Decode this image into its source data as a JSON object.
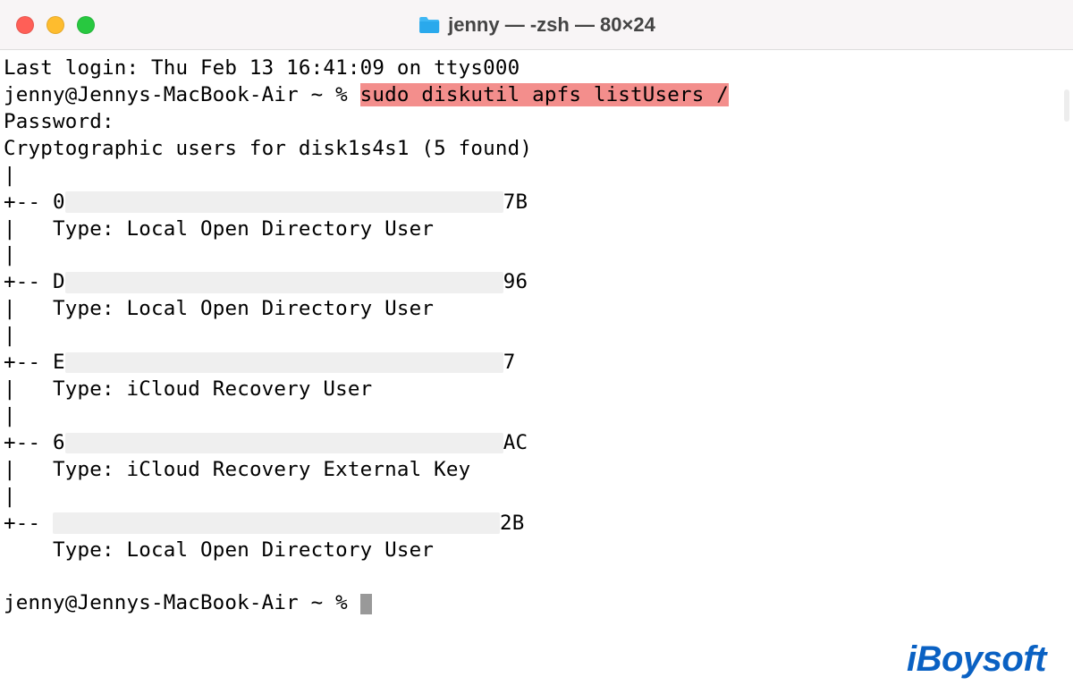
{
  "titlebar": {
    "title": "jenny — -zsh — 80×24"
  },
  "terminal": {
    "last_login": "Last login: Thu Feb 13 16:41:09 on ttys000",
    "prompt1_prefix": "jenny@Jennys-MacBook-Air ~ % ",
    "command1": "sudo diskutil apfs listUsers /",
    "password_line": "Password:",
    "result_header": "Cryptographic users for disk1s4s1 (5 found)",
    "users": [
      {
        "prefix": "+-- 0",
        "suffix": "7B",
        "type": "Type: Local Open Directory User"
      },
      {
        "prefix": "+-- D",
        "suffix": "96",
        "type": "Type: Local Open Directory User"
      },
      {
        "prefix": "+-- E",
        "suffix": "7",
        "type": "Type: iCloud Recovery User"
      },
      {
        "prefix": "+-- 6",
        "suffix": "AC",
        "type": "Type: iCloud Recovery External Key"
      },
      {
        "prefix": "+-- ",
        "suffix": "2B",
        "type": "Type: Local Open Directory User"
      }
    ],
    "pipe": "|",
    "type_indent": "|   ",
    "type_indent_last": "    ",
    "prompt2": "jenny@Jennys-MacBook-Air ~ % "
  },
  "watermark": "iBoysoft",
  "colors": {
    "highlight": "#f38e8c",
    "redacted": "#efefef",
    "brand": "#0a61c3"
  }
}
